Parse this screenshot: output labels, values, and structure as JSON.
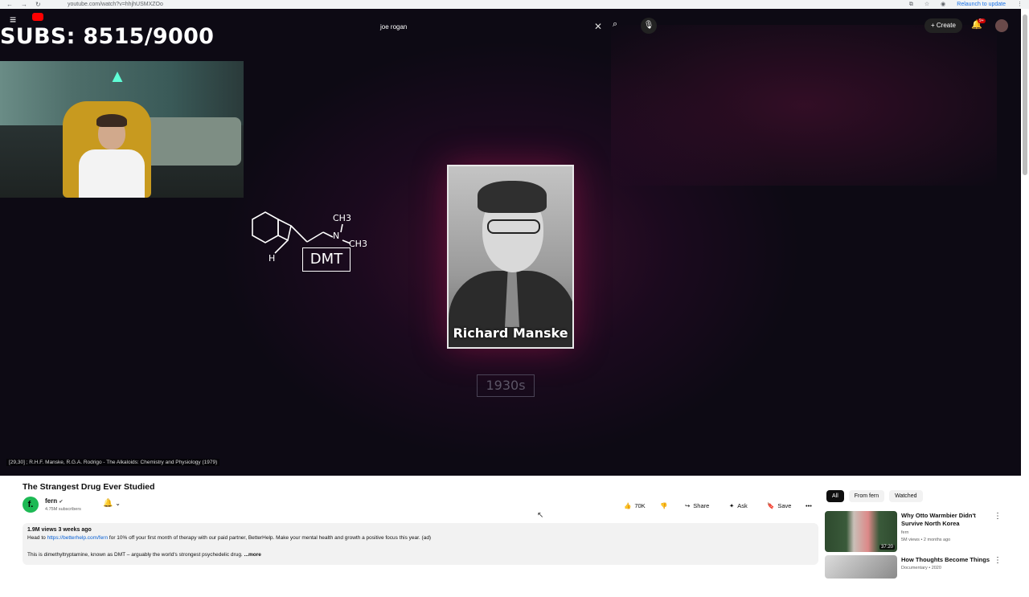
{
  "browser": {
    "url": "youtube.com/watch?v=hhjhUSMXZOo",
    "relaunch_label": "Relaunch to update"
  },
  "masthead": {
    "search_value": "joe rogan",
    "create_label": "Create",
    "notification_badge": "9+"
  },
  "overlay": {
    "subs_counter": "SUBS: 8515/9000"
  },
  "video_frame": {
    "molecule_label": "DMT",
    "molecule_groups": [
      "CH3",
      "N",
      "CH3",
      "H"
    ],
    "portrait_name": "Richard Manske",
    "year_label": "1930s",
    "citation": "[29,30] ; R.H.F. Manske, R.G.A. Rodrigo - The Alkaloids: Chemistry and Physiology (1979)"
  },
  "video_info": {
    "title": "The Strangest Drug Ever Studied",
    "channel_initial": "f.",
    "channel_name": "fern",
    "subscribers": "4.75M subscribers",
    "like_count": "70K",
    "share_label": "Share",
    "ask_label": "Ask",
    "save_label": "Save",
    "views_date": "1.9M views  3 weeks ago",
    "desc_prefix": "Head to ",
    "desc_link": "https://betterhelp.com/fern",
    "desc_suffix": " for 10% off your first month of therapy with our paid partner, BetterHelp. Make your mental health and growth a positive focus this year. (ad)",
    "desc_line2": "This is dimethyltryptamine, known as DMT – arguably the world's strongest psychedelic drug.",
    "more_label": "...more"
  },
  "sidebar": {
    "chips": [
      "All",
      "From fern",
      "Watched"
    ],
    "recommendations": [
      {
        "title": "Why Otto Warmbier Didn't Survive North Korea",
        "channel": "fern",
        "meta": "5M views • 2 months ago",
        "duration": "37:20"
      },
      {
        "title": "How Thoughts Become Things",
        "channel": "Documentary • 2020",
        "meta": "",
        "duration": ""
      }
    ]
  },
  "colors": {
    "accent_red": "#ff0000",
    "link_blue": "#065fd4",
    "channel_green": "#1db954"
  }
}
